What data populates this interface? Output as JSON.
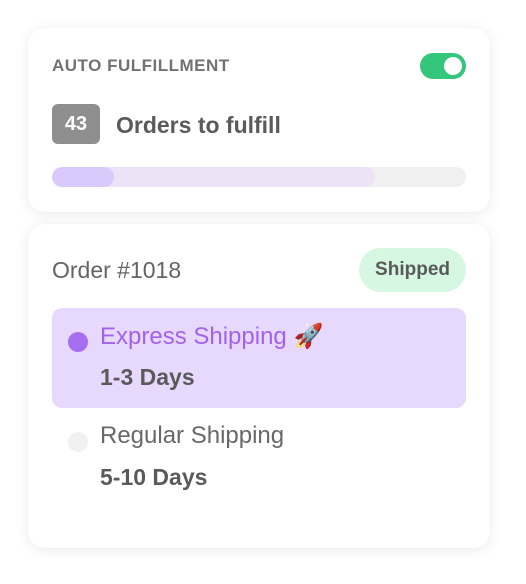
{
  "fulfillment": {
    "title": "AUTO FULFILLMENT",
    "toggle_on": true,
    "count": "43",
    "count_label": "Orders to fulfill",
    "progress": {
      "primary_fraction": 0.15,
      "secondary_fraction": 0.78
    },
    "colors": {
      "toggle": "#34c77b",
      "progress_primary": "#dac9fb",
      "progress_secondary": "#ece4f6"
    }
  },
  "order": {
    "title": "Order #1018",
    "status": "Shipped",
    "options": [
      {
        "name": "Express Shipping 🚀",
        "days": "1-3 Days",
        "selected": true
      },
      {
        "name": "Regular Shipping",
        "days": "5-10 Days",
        "selected": false
      }
    ],
    "colors": {
      "selected_bg": "#e7d9fd",
      "accent": "#a76ef2",
      "status_bg": "#d6f7e2"
    }
  }
}
